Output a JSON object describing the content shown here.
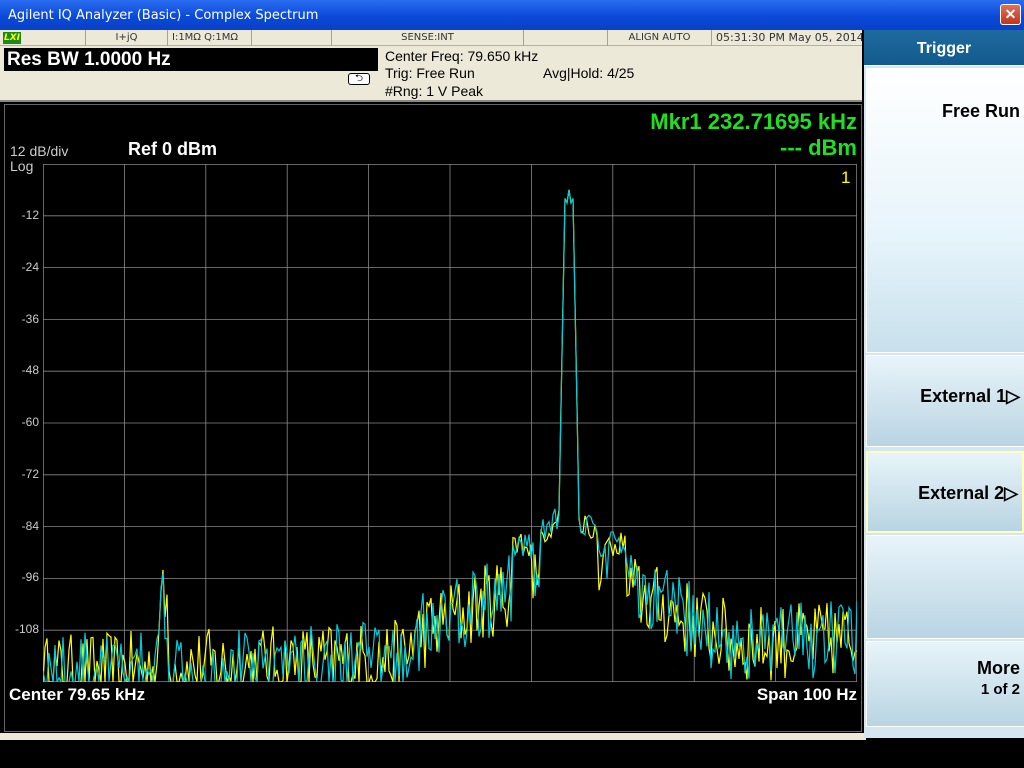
{
  "window": {
    "title": "Agilent IQ Analyzer (Basic) - Complex Spectrum",
    "close_glyph": "✕"
  },
  "status_bar": {
    "lxi": "LXI",
    "input": "I+jQ",
    "impedance": "I:1MΩ Q:1MΩ",
    "sense": "SENSE:INT",
    "align": "ALIGN AUTO",
    "datetime": "05:31:30 PM May 05, 2014"
  },
  "settings": {
    "res_bw": "Res BW 1.0000 Hz",
    "center_freq": "Center Freq: 79.650 kHz",
    "trig": "Trig: Free Run",
    "avg_hold": "Avg|Hold: 4/25",
    "range": "#Rng: 1 V Peak"
  },
  "graph": {
    "marker_freq": "Mkr1  232.71695 kHz",
    "marker_level": "--- dBm",
    "scale": "12 dB/div",
    "scale_type": "Log",
    "ref": "Ref  0 dBm",
    "marker_label": "1",
    "y_ticks": [
      "-12",
      "-24",
      "-36",
      "-48",
      "-60",
      "-72",
      "-84",
      "-96",
      "-108"
    ],
    "center": "Center  79.65 kHz",
    "span": "Span 100 Hz",
    "colors": {
      "trace1": "#ffff00",
      "trace2": "#00ccdd",
      "grid": "#888888",
      "marker": "#22dd22"
    }
  },
  "softkeys": {
    "menu_title": "Trigger",
    "free_run": "Free Run",
    "external1": "External 1▷",
    "external2": "External 2▷",
    "more": "More",
    "more_page": "1 of 2"
  }
}
